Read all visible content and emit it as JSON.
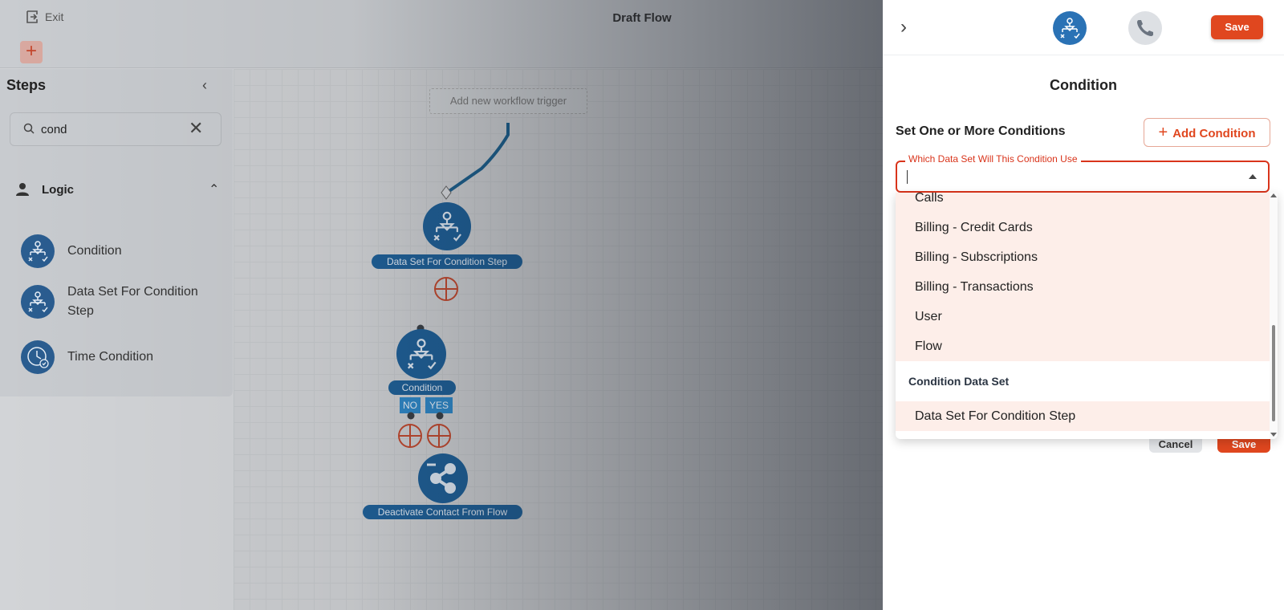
{
  "app": {
    "exit_label": "Exit",
    "title": "Draft Flow"
  },
  "steps_panel": {
    "title": "Steps",
    "search": {
      "value": "cond"
    },
    "category": "Logic",
    "items": [
      {
        "label": "Condition",
        "icon": "condition-icon"
      },
      {
        "label": "Data Set For Condition Step",
        "icon": "condition-icon"
      },
      {
        "label": "Time Condition",
        "icon": "clock-icon"
      }
    ]
  },
  "canvas": {
    "trigger_placeholder": "Add new workflow trigger",
    "nodes": {
      "dataset_label": "Data Set For Condition Step",
      "condition_label": "Condition",
      "no_tag": "NO",
      "yes_tag": "YES",
      "deactivate_label": "Deactivate Contact From Flow"
    }
  },
  "panel": {
    "save_label": "Save",
    "title": "Condition",
    "set_label": "Set One or More Conditions",
    "add_condition_label": "Add Condition",
    "select_legend": "Which Data Set Will This Condition Use",
    "dropdown": {
      "partial_item": "Calls",
      "items": [
        "Billing - Credit Cards",
        "Billing - Subscriptions",
        "Billing - Transactions",
        "User",
        "Flow"
      ],
      "group_header": "Condition Data Set",
      "group_items": [
        "Data Set For Condition Step"
      ]
    },
    "cancel_label": "Cancel",
    "footer_save_label": "Save"
  },
  "colors": {
    "accent": "#e0471f",
    "node_blue": "#1f5f96",
    "highlight": "#fdeee9"
  }
}
